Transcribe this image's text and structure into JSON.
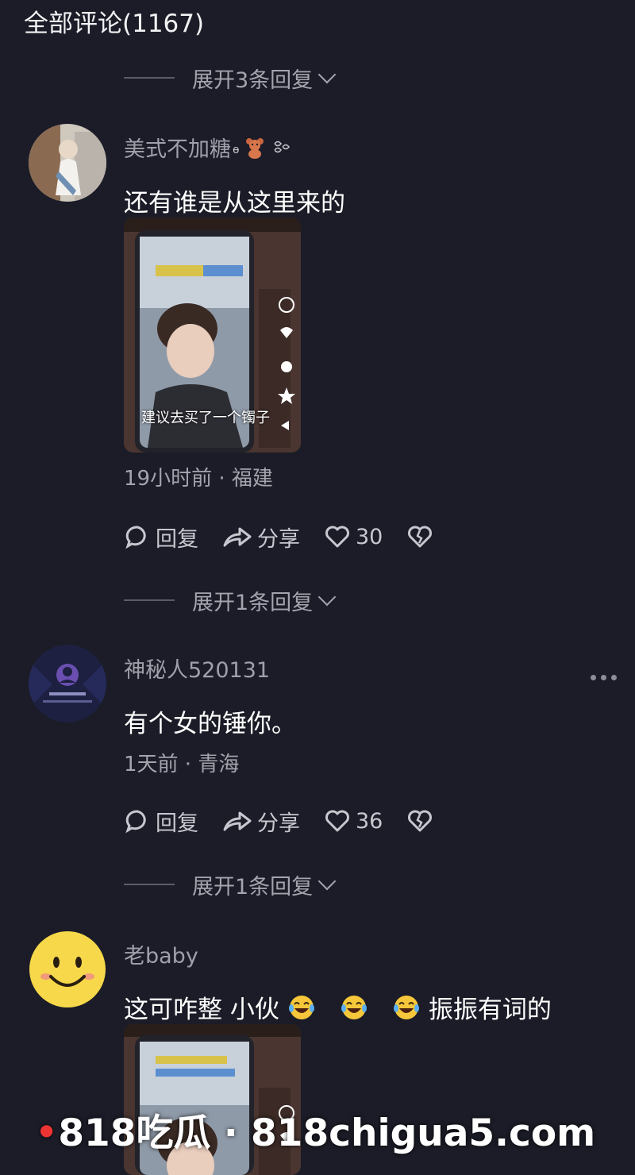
{
  "header": {
    "title": "全部评论(1167)"
  },
  "expand_1": {
    "label": "展开3条回复"
  },
  "comments": [
    {
      "username": "美式不加糖",
      "text": "还有谁是从这里来的",
      "image_caption": "建议去买了一个镯子",
      "meta": "19小时前 · 福建",
      "actions": {
        "reply": "回复",
        "share": "分享",
        "likes": "30"
      },
      "expand": "展开1条回复"
    },
    {
      "username": "神秘人520131",
      "text": "有个女的锤你。",
      "meta": "1天前 · 青海",
      "actions": {
        "reply": "回复",
        "share": "分享",
        "likes": "36"
      },
      "expand": "展开1条回复"
    },
    {
      "username": "老baby",
      "text_before": "这可咋整 小伙",
      "text_after": "振振有词的",
      "emoji_icon": "laugh-cry-emoji"
    }
  ],
  "watermark": {
    "text": "818吃瓜 · 818chigua5.com"
  },
  "colors": {
    "background": "#1b1c27",
    "secondary_text": "#a3a4ad",
    "username": "#9fa0aa"
  }
}
